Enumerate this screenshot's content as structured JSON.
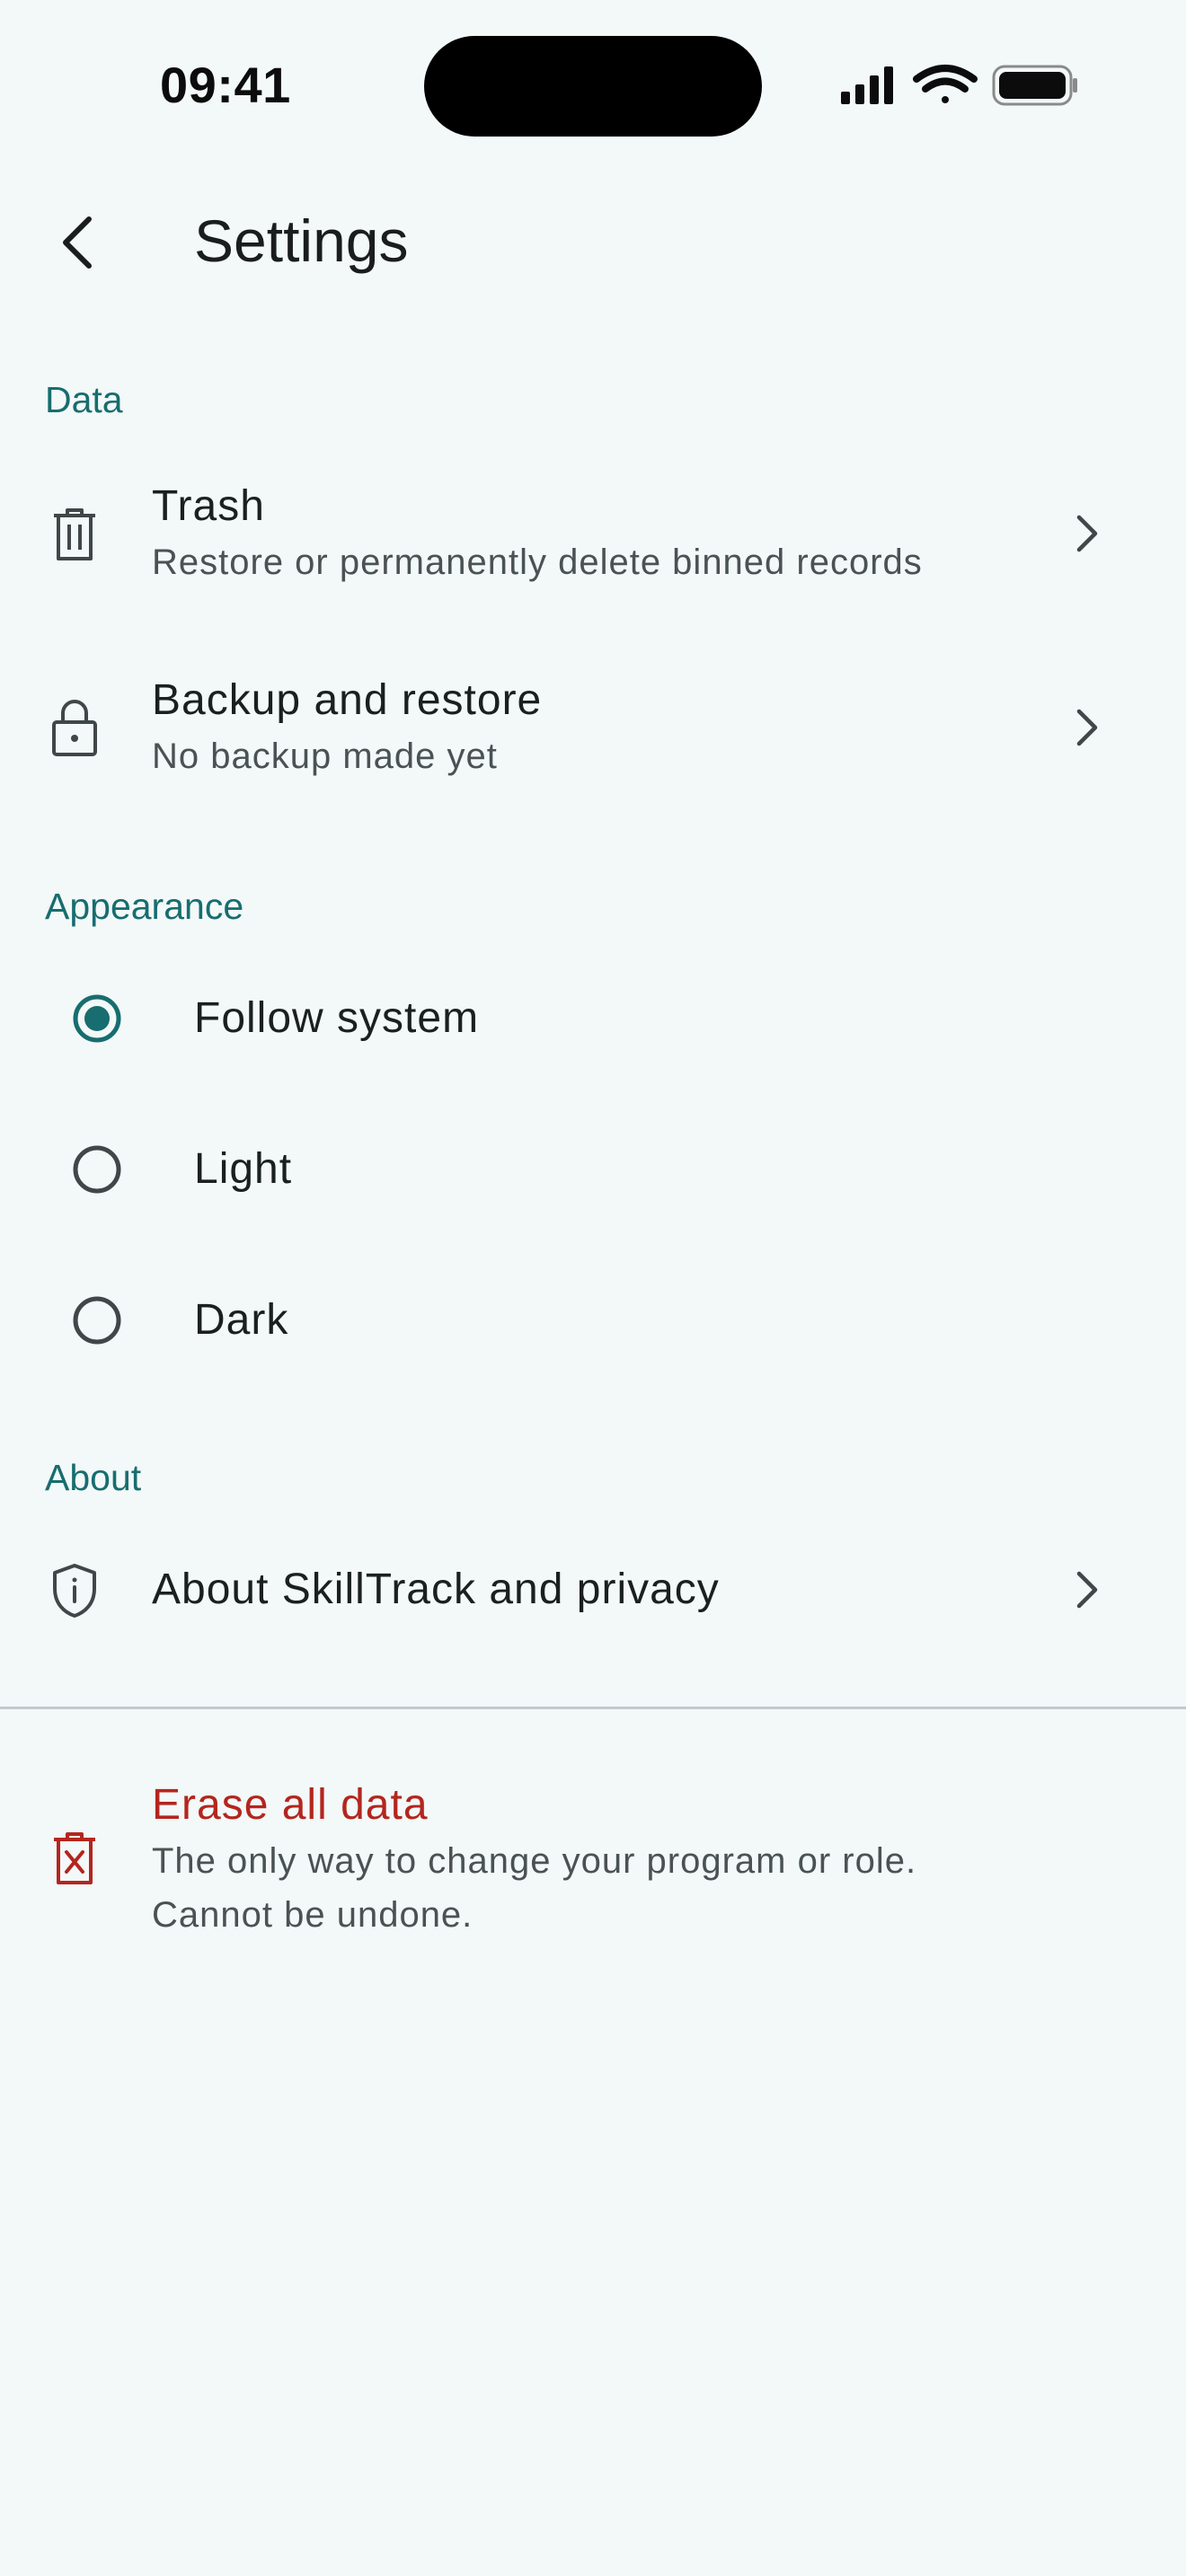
{
  "status_bar": {
    "time": "09:41"
  },
  "header": {
    "title": "Settings"
  },
  "sections": {
    "data": {
      "label": "Data",
      "items": [
        {
          "title": "Trash",
          "subtitle": "Restore or permanently delete binned records",
          "icon": "trash-icon"
        },
        {
          "title": "Backup and restore",
          "subtitle": "No backup made yet",
          "icon": "lock-icon"
        }
      ]
    },
    "appearance": {
      "label": "Appearance",
      "options": [
        {
          "label": "Follow system",
          "selected": true
        },
        {
          "label": "Light",
          "selected": false
        },
        {
          "label": "Dark",
          "selected": false
        }
      ]
    },
    "about": {
      "label": "About",
      "items": [
        {
          "title": "About SkillTrack and privacy",
          "icon": "shield-info-icon"
        }
      ]
    }
  },
  "danger": {
    "title": "Erase all data",
    "subtitle_line1": "The only way to change your program or role.",
    "subtitle_line2": "Cannot be undone.",
    "icon": "delete-x-icon"
  },
  "colors": {
    "accent": "#176d6f",
    "danger": "#b3261e",
    "background": "#f3f8f8"
  }
}
